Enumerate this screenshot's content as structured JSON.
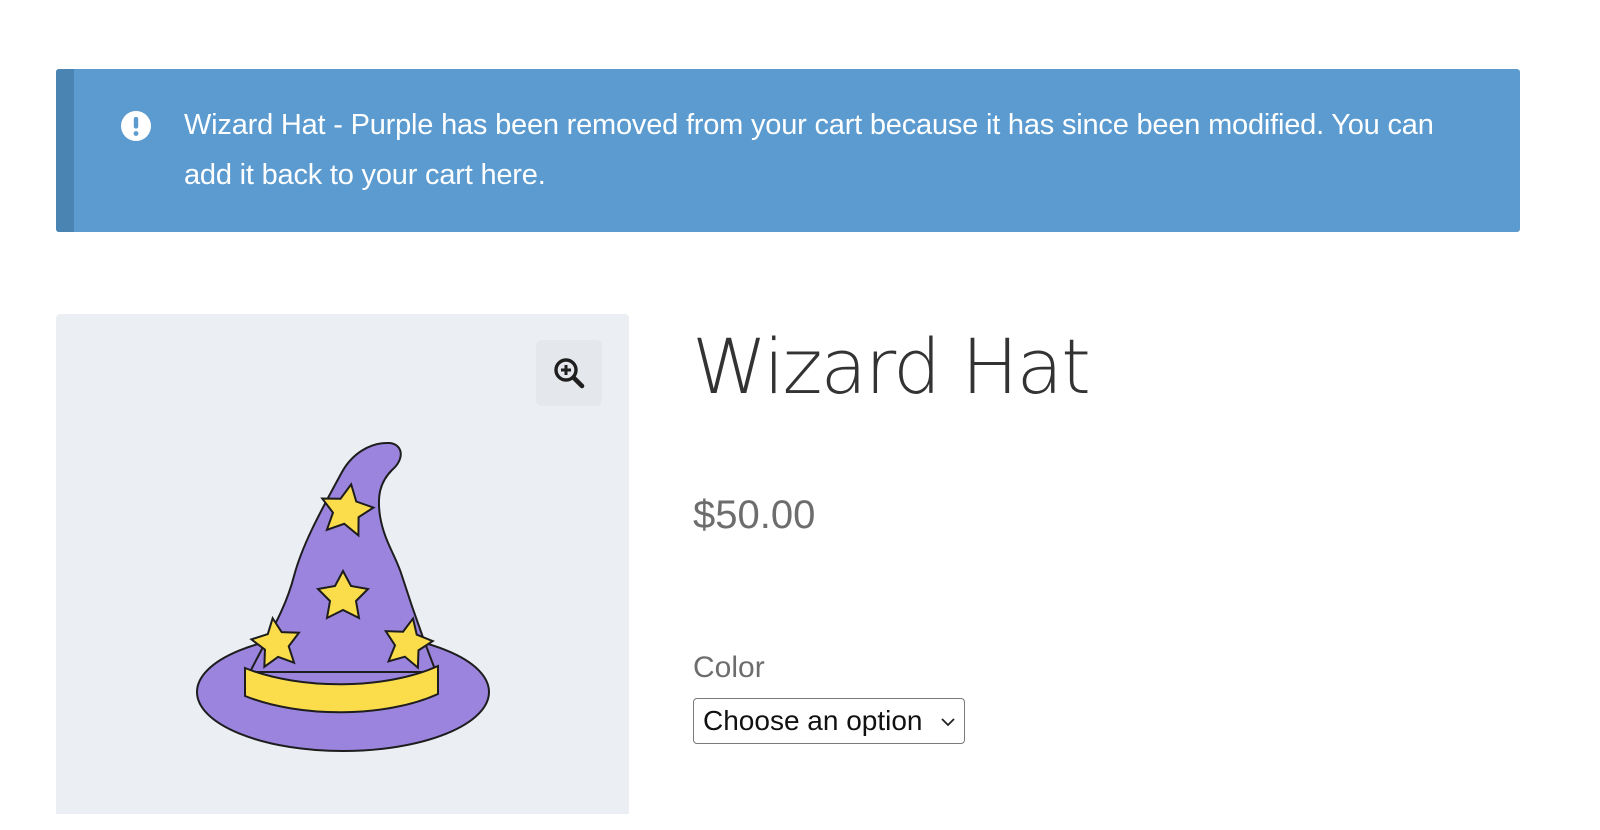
{
  "notice": {
    "message": "Wizard Hat - Purple has been removed from your cart because it has since been modified. You can add it back to your cart",
    "link_text": "here",
    "trailing": ".",
    "icon": "exclamation-circle-icon",
    "background_color": "#5b9bd0",
    "accent_color": "#4a84b2"
  },
  "product": {
    "title": "Wizard Hat",
    "price": "$50.00",
    "image_icon": "wizard-hat-image",
    "zoom_icon": "magnify-plus-icon"
  },
  "variation": {
    "label": "Color",
    "selected": "Choose an option",
    "chevron_icon": "chevron-down-icon"
  }
}
